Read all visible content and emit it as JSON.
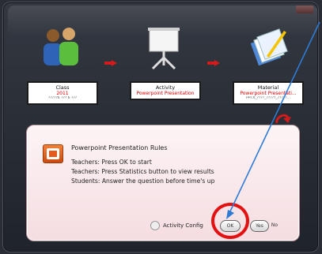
{
  "steps": [
    {
      "title": "Class",
      "value": "2011",
      "sub": "?????6 ??? 6 ???"
    },
    {
      "title": "Activity",
      "value": "Powerpoint Presentation",
      "sub": ""
    },
    {
      "title": "Material",
      "value": "Powerpoint Presentati...",
      "sub": "PPTX_????_?????_?????..."
    }
  ],
  "dialog": {
    "title": "Powerpoint Presentation Rules",
    "line1": "Teachers: Press OK to start",
    "line2": "Teachers: Press Statistics button to view results",
    "line3": "Students: Answer the question before time's up",
    "config_label": "Activity Config",
    "ok_label": "OK",
    "yes_label": "Yes",
    "no_label": "No"
  },
  "colors": {
    "accent": "#d21b1b",
    "annotation_blue": "#2e7bd6",
    "ring": "#e21212"
  }
}
